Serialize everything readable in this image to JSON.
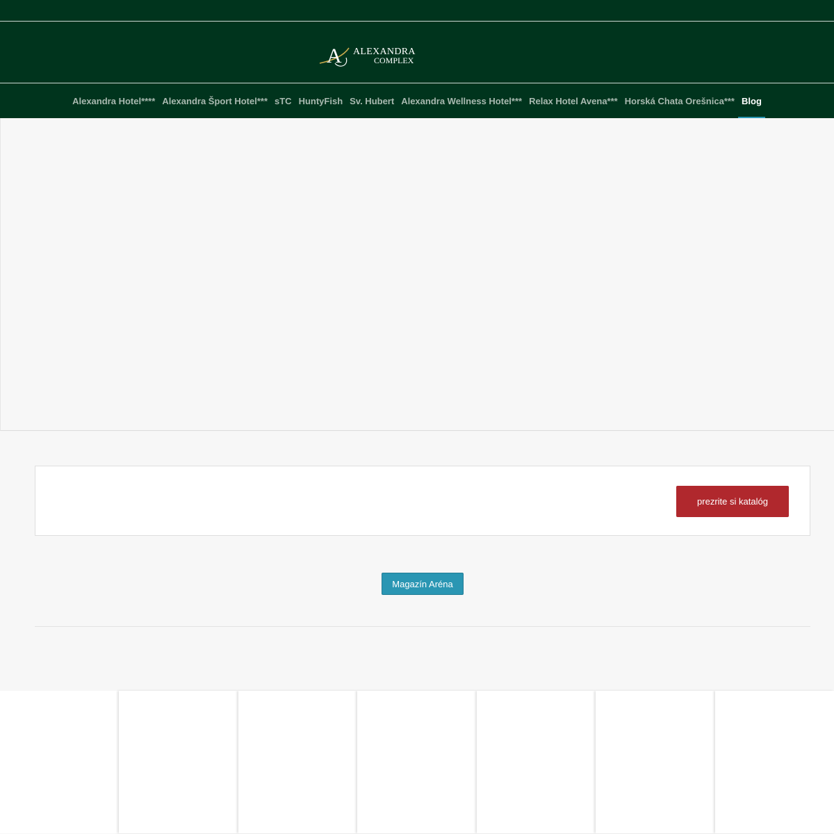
{
  "brand": {
    "name_line1": "Alexandra",
    "name_line2": "Complex",
    "colors": {
      "header_bg": "#00341d",
      "accent_blue": "#2a96b3",
      "accent_red": "#b0282d",
      "logo_gold": "#c8a94c"
    }
  },
  "nav": {
    "items": [
      {
        "label": "Alexandra Hotel****"
      },
      {
        "label": "Alexandra Šport Hotel***"
      },
      {
        "label": "sTC"
      },
      {
        "label": "HuntyFish"
      },
      {
        "label": "Sv. Hubert"
      },
      {
        "label": "Alexandra Wellness Hotel***"
      },
      {
        "label": "Relax Hotel Avena***"
      },
      {
        "label": "Horská Chata Orešnica***"
      },
      {
        "label": "Blog"
      }
    ],
    "active_index": 8
  },
  "catalog": {
    "button_label": "prezrite si katalóg"
  },
  "magazine": {
    "button_label": "Magazín Aréna"
  }
}
